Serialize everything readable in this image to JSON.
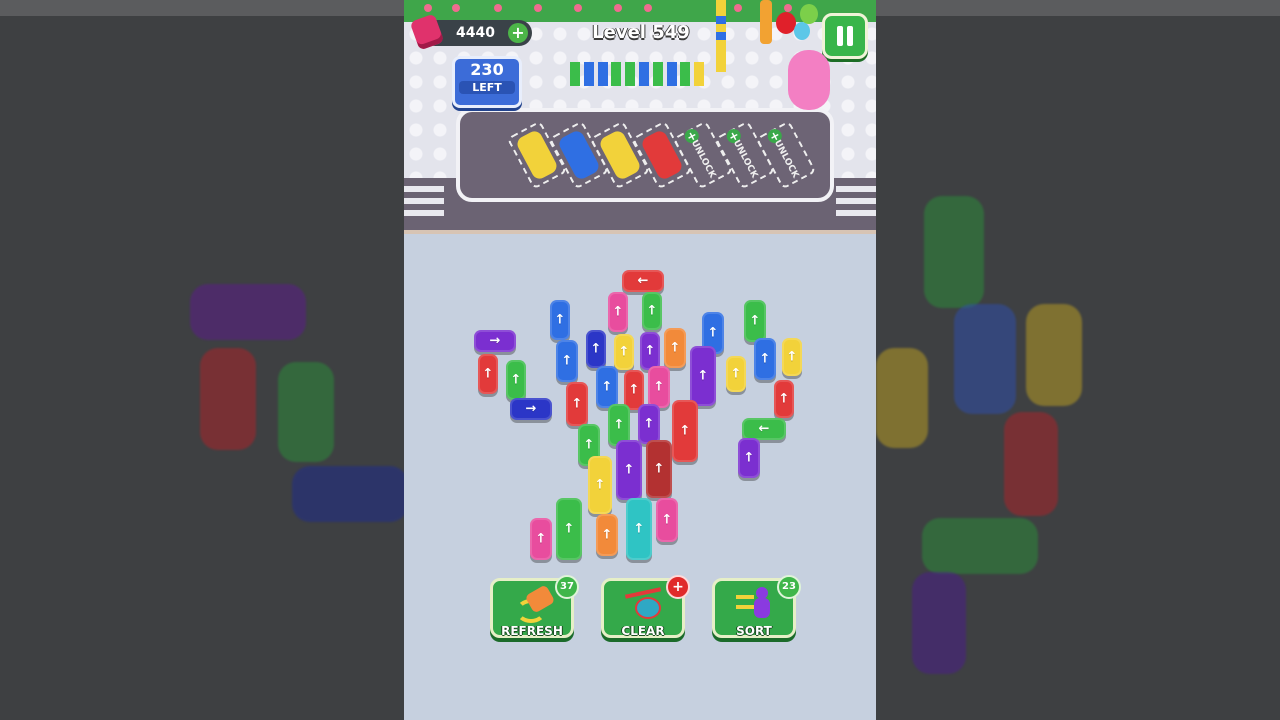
{
  "hud": {
    "coins": "4440",
    "level_label": "Level 549",
    "cars_left_count": "230",
    "cars_left_label": "LEFT"
  },
  "parking_slots": [
    {
      "state": "occupied",
      "color": "#f2d23a"
    },
    {
      "state": "occupied",
      "color": "#2f6fe3"
    },
    {
      "state": "occupied",
      "color": "#f2d23a"
    },
    {
      "state": "occupied",
      "color": "#e23a3a"
    },
    {
      "state": "locked",
      "label": "UNLOCK"
    },
    {
      "state": "locked",
      "label": "UNLOCK"
    },
    {
      "state": "locked",
      "label": "UNLOCK"
    }
  ],
  "boosters": [
    {
      "name": "refresh",
      "label": "REFRESH",
      "count": "37",
      "icon": "refresh-car-icon"
    },
    {
      "name": "clear",
      "label": "CLEAR",
      "count": "+",
      "icon": "helicopter-icon"
    },
    {
      "name": "sort",
      "label": "SORT",
      "count": "23",
      "icon": "sort-people-icon"
    }
  ],
  "queue_colors": [
    "#3bbd4a",
    "#2f6fe3",
    "#2f6fe3",
    "#3bbd4a",
    "#3bbd4a",
    "#2f6fe3",
    "#3bbd4a",
    "#2f6fe3",
    "#3bbd4a",
    "#f2d23a"
  ],
  "colors": {
    "red": "#e23a3a",
    "blue": "#2f6fe3",
    "green": "#3bbd4a",
    "yellow": "#f2d23a",
    "purple": "#7b2fd0",
    "pink": "#e84d9e",
    "orange": "#f28a3a",
    "teal": "#2fc4c4",
    "maroon": "#b33131",
    "navy": "#2b36c7"
  }
}
